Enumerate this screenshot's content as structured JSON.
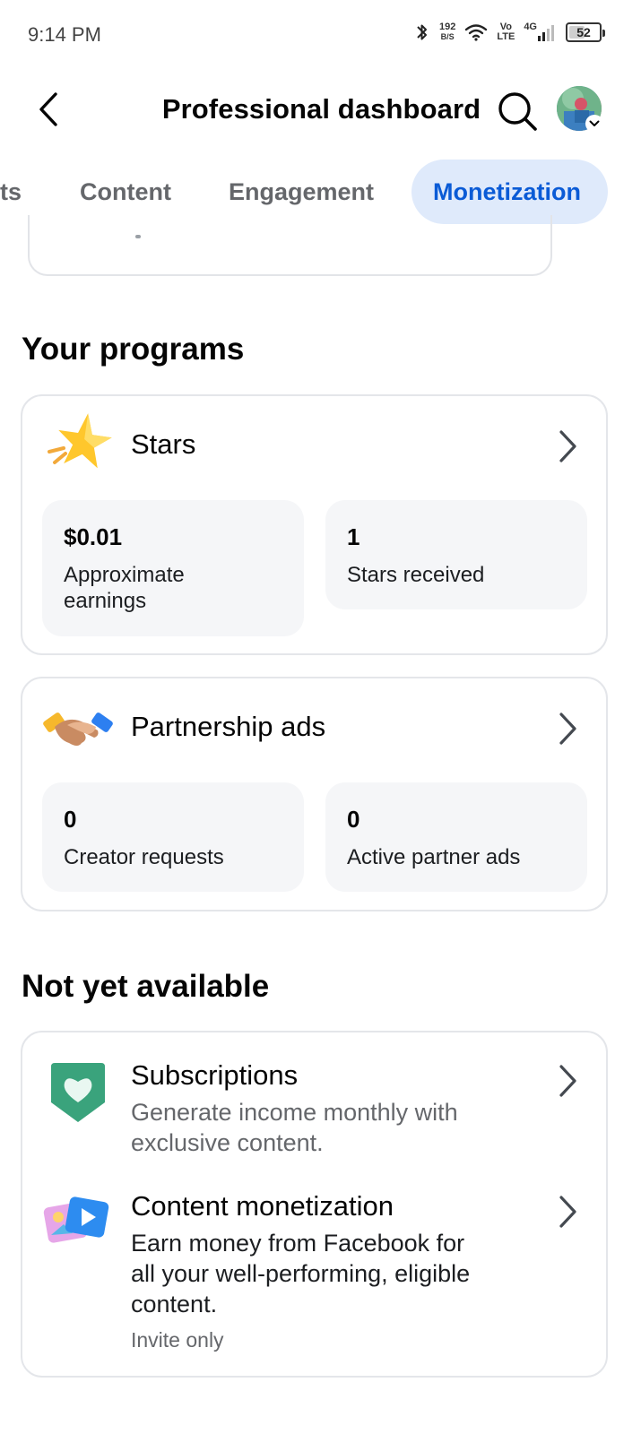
{
  "status_bar": {
    "time": "9:14 PM",
    "net_speed_value": "192",
    "net_speed_unit": "B/S",
    "volte_top": "Vo",
    "volte_bottom": "LTE",
    "network": "4G",
    "battery": "52",
    "battery_level": 0.52
  },
  "header": {
    "title": "Professional dashboard",
    "icons": [
      "back-arrow-icon",
      "search-icon",
      "avatar",
      "chevron-down-icon"
    ]
  },
  "tabs": [
    {
      "label": "ts",
      "active": false
    },
    {
      "label": "Content",
      "active": false
    },
    {
      "label": "Engagement",
      "active": false
    },
    {
      "label": "Monetization",
      "active": true
    }
  ],
  "programs": {
    "title": "Your programs",
    "stars": {
      "title": "Stars",
      "icon": "star-icon",
      "stats": [
        {
          "value": "$0.01",
          "label": "Approximate earnings"
        },
        {
          "value": "1",
          "label": "Stars received"
        }
      ]
    },
    "partnership": {
      "title": "Partnership ads",
      "icon": "handshake-icon",
      "stats": [
        {
          "value": "0",
          "label": "Creator requests"
        },
        {
          "value": "0",
          "label": "Active partner ads"
        }
      ]
    }
  },
  "not_available": {
    "title": "Not yet available",
    "items": [
      {
        "title": "Subscriptions",
        "description": "Generate income monthly with exclusive content.",
        "icon": "heart-badge-icon"
      },
      {
        "title": "Content monetization",
        "description": "Earn money from Facebook for all your well-performing, eligible content.",
        "note": "Invite only",
        "icon": "media-play-icon"
      }
    ]
  },
  "colors": {
    "accent": "#0a5bd6",
    "tab_active_bg": "#dfeafb",
    "muted_text": "#65676b",
    "card_border": "#e4e6ea",
    "stat_bg": "#f5f6f8"
  }
}
